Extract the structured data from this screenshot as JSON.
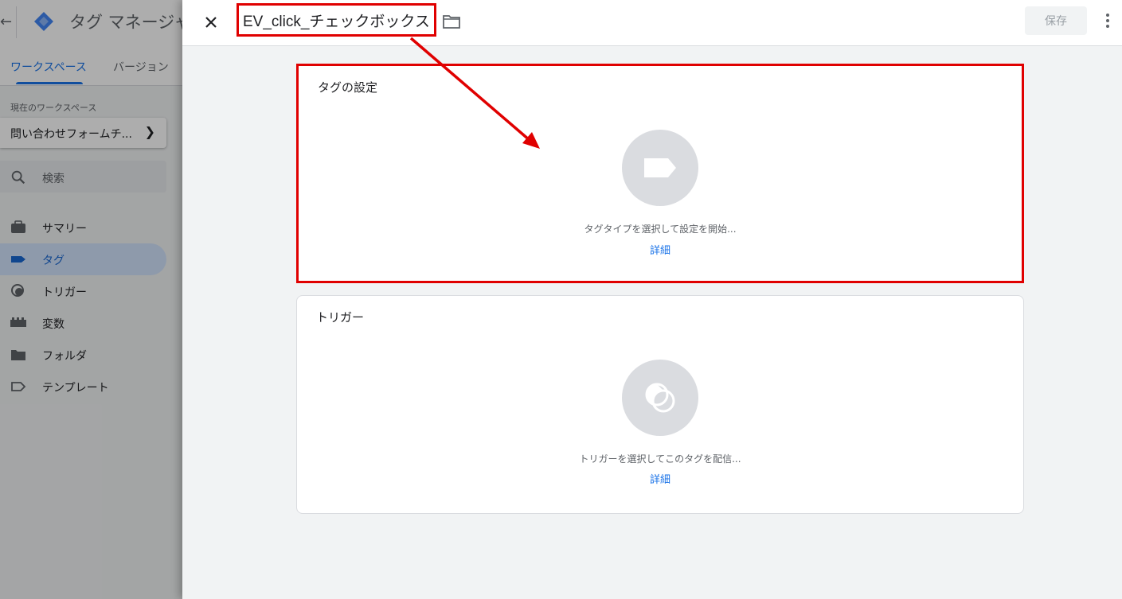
{
  "app": {
    "title": "タグ マネージャー",
    "tabs": [
      {
        "label": "ワークスペース",
        "active": true
      },
      {
        "label": "バージョン",
        "active": false
      }
    ],
    "workspace_label": "現在のワークスペース",
    "workspace_name": "問い合わせフォームチ...",
    "search_placeholder": "検索",
    "nav": [
      {
        "label": "サマリー",
        "icon": "briefcase-icon",
        "active": false
      },
      {
        "label": "タグ",
        "icon": "tag-icon",
        "active": true
      },
      {
        "label": "トリガー",
        "icon": "trigger-icon",
        "active": false
      },
      {
        "label": "変数",
        "icon": "variables-icon",
        "active": false
      },
      {
        "label": "フォルダ",
        "icon": "folder-icon",
        "active": false
      },
      {
        "label": "テンプレート",
        "icon": "template-icon",
        "active": false
      }
    ]
  },
  "panel": {
    "tag_name": "EV_click_チェックボックス",
    "save_label": "保存",
    "tag_config": {
      "title": "タグの設定",
      "hint": "タグタイプを選択して設定を開始...",
      "link": "詳細"
    },
    "trigger": {
      "title": "トリガー",
      "hint": "トリガーを選択してこのタグを配信...",
      "link": "詳細"
    }
  },
  "colors": {
    "accent": "#1a73e8",
    "annotation": "#e00000",
    "active_nav_bg": "#d2e3fc"
  }
}
